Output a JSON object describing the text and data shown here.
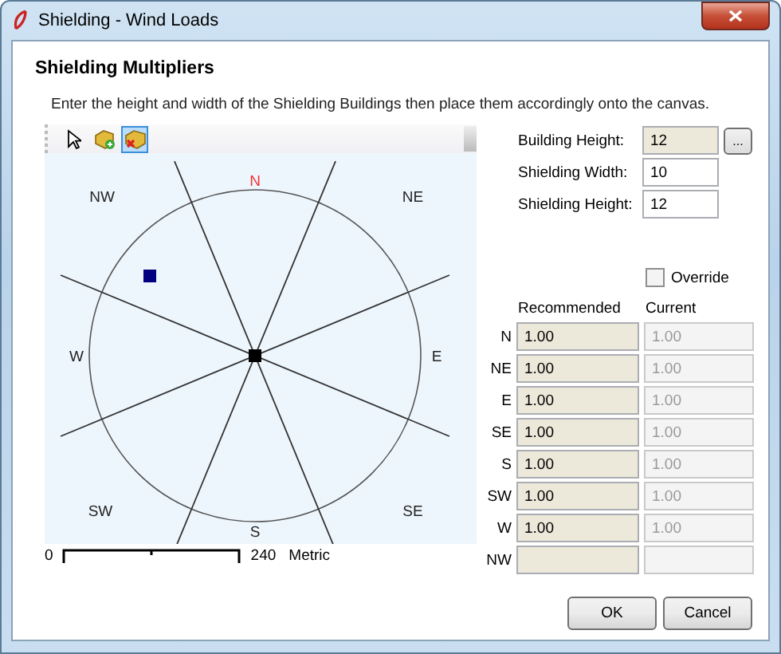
{
  "window": {
    "title": "Shielding - Wind Loads"
  },
  "heading": "Shielding Multipliers",
  "instruction": "Enter the height and width of the Shielding Buildings then place them accordingly onto the canvas.",
  "toolbar": [
    {
      "kind": "pointer",
      "selected": false
    },
    {
      "kind": "add",
      "selected": false
    },
    {
      "kind": "delete",
      "selected": true
    }
  ],
  "compass": {
    "labels": [
      {
        "text": "N",
        "highlighted": true
      },
      {
        "text": "NE",
        "highlighted": false
      },
      {
        "text": "E",
        "highlighted": false
      },
      {
        "text": "SE",
        "highlighted": false
      },
      {
        "text": "S",
        "highlighted": false
      },
      {
        "text": "SW",
        "highlighted": false
      },
      {
        "text": "W",
        "highlighted": false
      },
      {
        "text": "NW",
        "highlighted": false
      }
    ]
  },
  "scale": {
    "start": "0",
    "end": "240",
    "units": "Metric"
  },
  "fields": [
    {
      "label": "Building Height:",
      "value": "12",
      "readonly": true,
      "browse": "..."
    },
    {
      "label": "Shielding Width:",
      "value": "10",
      "readonly": false
    },
    {
      "label": "Shielding Height:",
      "value": "12",
      "readonly": false
    }
  ],
  "override": {
    "label": "Override",
    "checked": false
  },
  "multipliers": {
    "columns": [
      "Recommended",
      "Current"
    ],
    "rows": [
      {
        "direction": "N",
        "recommended": "1.00",
        "current": "1.00"
      },
      {
        "direction": "NE",
        "recommended": "1.00",
        "current": "1.00"
      },
      {
        "direction": "E",
        "recommended": "1.00",
        "current": "1.00"
      },
      {
        "direction": "SE",
        "recommended": "1.00",
        "current": "1.00"
      },
      {
        "direction": "S",
        "recommended": "1.00",
        "current": "1.00"
      },
      {
        "direction": "SW",
        "recommended": "1.00",
        "current": "1.00"
      },
      {
        "direction": "W",
        "recommended": "1.00",
        "current": "1.00"
      },
      {
        "direction": "NW"
      }
    ]
  },
  "buttons": [
    "OK",
    "Cancel"
  ]
}
